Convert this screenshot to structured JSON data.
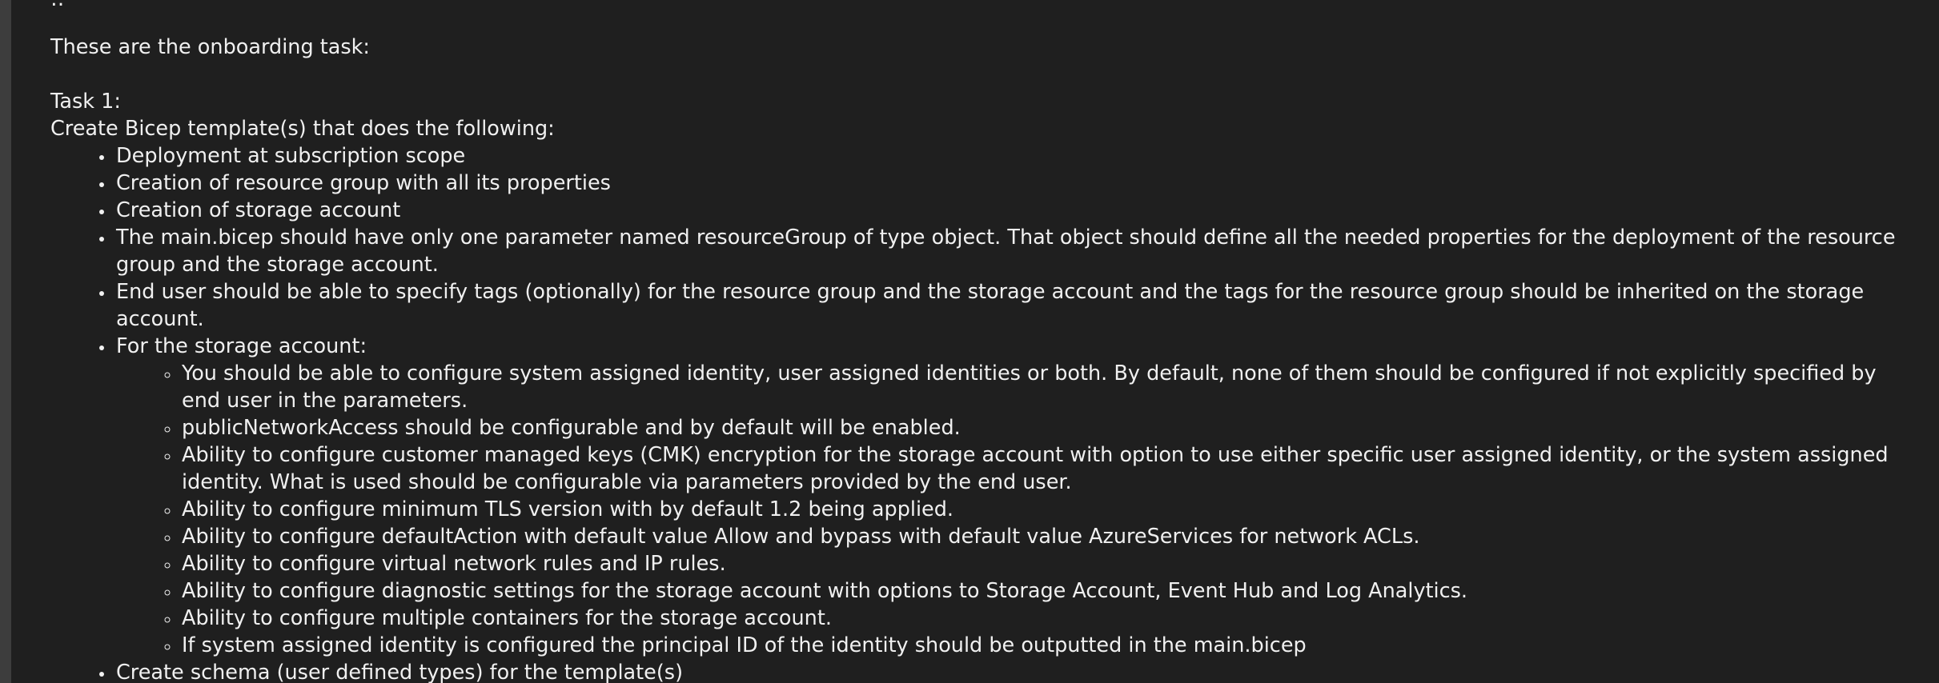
{
  "partial_top_line": "‥ · ·",
  "intro": "These are the onboarding task:",
  "task_heading": "Task 1:",
  "task_description": "Create Bicep template(s) that does the following:",
  "items": [
    "Deployment at subscription scope",
    "Creation of resource group with all its properties",
    "Creation of storage account",
    "The main.bicep should have only one parameter named resourceGroup of type object. That object should define all the needed properties for the deployment of the resource group and the storage account.",
    "End user should be able to specify tags (optionally) for the resource group and the storage account and the tags for the resource group should be inherited on the storage account.",
    "For the storage account:"
  ],
  "storage_items": [
    "You should be able to configure system assigned identity, user assigned identities or both. By default, none of them should be configured if not explicitly specified by end user in the parameters.",
    "publicNetworkAccess should be configurable and by default will be enabled.",
    "Ability to configure customer managed keys (CMK) encryption for the storage account with option to use either specific user assigned identity, or the system assigned identity. What is used should be configurable via parameters provided by the end user.",
    "Ability to configure minimum TLS version with by default 1.2 being applied.",
    "Ability to configure defaultAction with default value Allow and bypass with default value AzureServices for network ACLs.",
    "Ability to configure virtual network rules and IP rules.",
    "Ability to configure diagnostic settings for the storage account with options to Storage Account, Event Hub and Log Analytics.",
    "Ability to configure multiple containers for the storage account.",
    "If system assigned identity is configured the principal ID of the identity should be outputted in the main.bicep"
  ],
  "last_item": "Create schema (user defined types) for the template(s)"
}
